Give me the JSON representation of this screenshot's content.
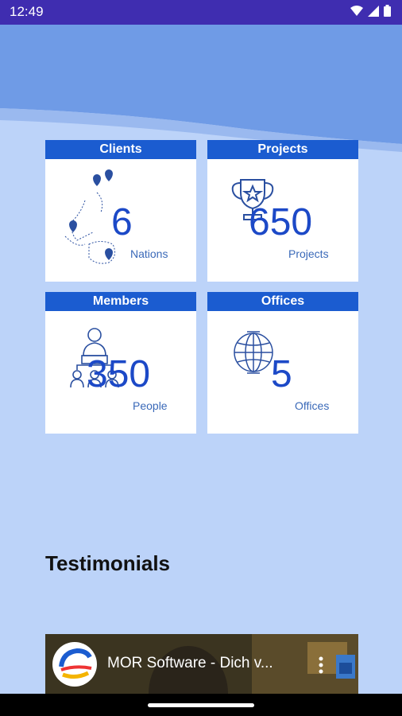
{
  "status": {
    "time": "12:49"
  },
  "stats": [
    {
      "title": "Clients",
      "value": "6",
      "unit": "Nations",
      "icon": "map-pins-icon"
    },
    {
      "title": "Projects",
      "value": "650",
      "unit": "Projects",
      "icon": "trophy-icon"
    },
    {
      "title": "Members",
      "value": "350",
      "unit": "People",
      "icon": "team-icon"
    },
    {
      "title": "Offices",
      "value": "5",
      "unit": "Offices",
      "icon": "globe-icon"
    }
  ],
  "testimonials": {
    "heading": "Testimonials",
    "video_title": "MOR Software - Dich v..."
  },
  "colors": {
    "accent": "#1b5cd0",
    "status_bar": "#3f2db0",
    "background": "#bcd3f9"
  }
}
